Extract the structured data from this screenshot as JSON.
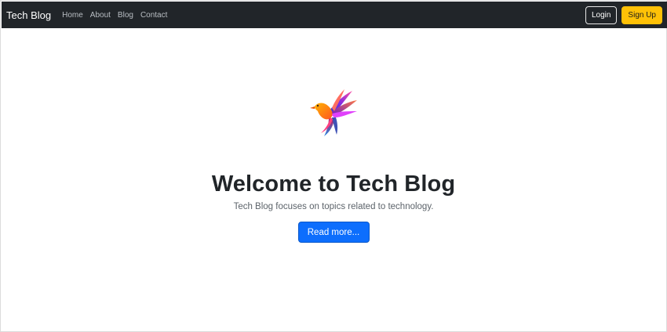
{
  "navbar": {
    "brand": "Tech Blog",
    "links": [
      {
        "label": "Home"
      },
      {
        "label": "About"
      },
      {
        "label": "Blog"
      },
      {
        "label": "Contact"
      }
    ],
    "login_label": "Login",
    "signup_label": "Sign Up",
    "background_color": "#212529",
    "signup_color": "#ffc107"
  },
  "hero": {
    "logo_icon": "colorful-bird-icon",
    "title": "Welcome to Tech Blog",
    "subtitle": "Tech Blog focuses on topics related to technology.",
    "read_more_label": "Read more...",
    "button_color": "#0d6efd"
  }
}
